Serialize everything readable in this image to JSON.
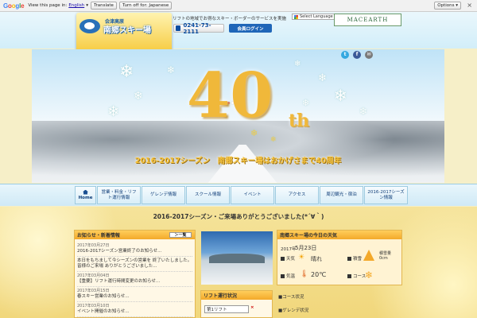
{
  "translate_bar": {
    "prompt": "View this page in:",
    "language": "English",
    "translate_label": "Translate",
    "turn_off_label": "Turn off for: Japanese",
    "options_label": "Options ▾",
    "close_glyph": "×"
  },
  "header": {
    "logo_sub": "会津高原",
    "logo_name": "南郷スキー場",
    "tagline": "リフトの地域でお得なスキー・ボーダーのサービスを実施",
    "phone": "0241-73-2111",
    "login_label": "会員ログイン",
    "language_select": "Select Language",
    "partner_logo": "MACEARTH"
  },
  "banner": {
    "big_number": "40",
    "big_suffix": "th",
    "caption": "2016-2017シーズン　南郷スキー場はおかげさまで40周年"
  },
  "nav": {
    "items": [
      {
        "label": "Home"
      },
      {
        "label": "営業・料金・リフト運行情報"
      },
      {
        "label": "ゲレンデ情報"
      },
      {
        "label": "スクール情報"
      },
      {
        "label": "イベント"
      },
      {
        "label": "アクセス"
      },
      {
        "label": "周辺観光・宿泊"
      },
      {
        "label": "2016-2017シーズン情報"
      }
    ]
  },
  "main": {
    "title": "2016-2017シーズン・ご来場ありがとうございました(*´∀｀)"
  },
  "news": {
    "title": "お知らせ・新着情報",
    "more_label": "＞一覧",
    "items": [
      {
        "date": "2017年03月27日",
        "text": "2016-2017シーズン営業終了のお知らせ..."
      },
      {
        "date": "",
        "text": "本日をもちまして今シーズンの営業を 終了いたしました。皆様のご来場 ありがとうございました..."
      },
      {
        "date": "2017年03月04日",
        "text": "【重要】リフト運行時間変更のお知らせ..."
      },
      {
        "date": "2017年03月15日",
        "text": "春スキー営業のお知らせ..."
      },
      {
        "date": "2017年03月10日",
        "text": "イベント開催のお知らせ..."
      }
    ]
  },
  "weather": {
    "title": "南郷スキー場の今日の天気",
    "year": "2017年",
    "date": "5月23日",
    "condition_label": "天気",
    "condition": "晴れ",
    "temp_label": "気温",
    "temp": "20",
    "temp_unit": "℃",
    "snow_label": "積雪",
    "snow_value": "積雪量 0cm",
    "course_label": "コース"
  },
  "status": {
    "title": "リフト運行状況",
    "lift1": "第1リフト",
    "lift1_state": "×",
    "course_title": "■コース状況",
    "course2_title": "■ゲレンデ状況"
  },
  "colors": {
    "accent": "#f3a92a",
    "navy": "#103f7a",
    "login": "#1f66b8"
  }
}
